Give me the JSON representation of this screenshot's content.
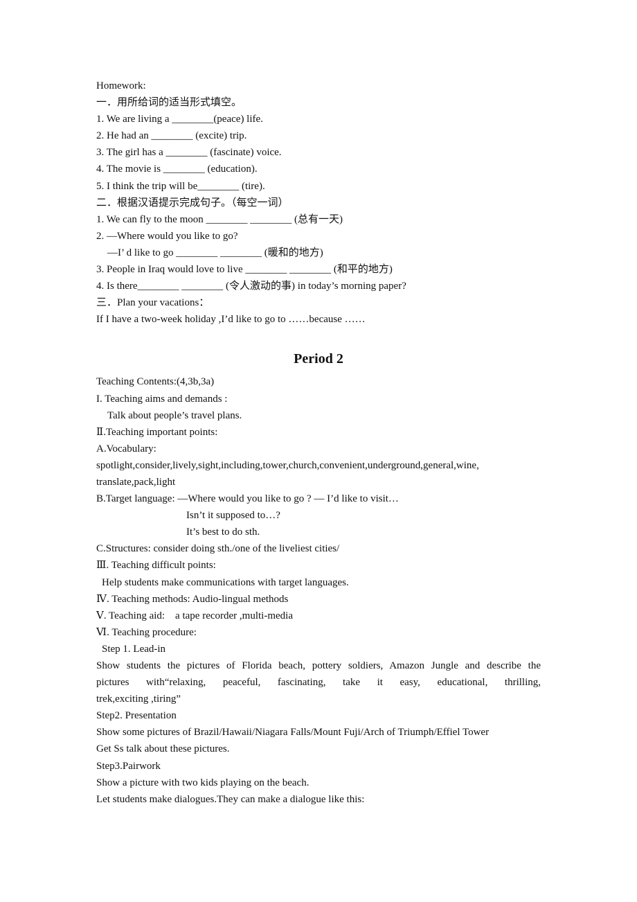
{
  "homework": {
    "heading": "Homework:",
    "section1": {
      "title": "一．用所给词的适当形式填空。",
      "items": [
        "1. We are living a ________(peace) life.",
        "2. He had an ________ (excite) trip.",
        "3. The girl has a ________ (fascinate) voice.",
        "4. The movie is ________ (education).",
        "5. I think the trip will be________ (tire)."
      ]
    },
    "section2": {
      "title": "二．根据汉语提示完成句子。（每空一词）",
      "items": [
        "1. We can fly to the moon ________ ________ (总有一天)",
        "2. —Where would you like to go?",
        "—I’ d like to go ________ ________ (暖和的地方)",
        "3. People in Iraq would love to live ________ ________ (和平的地方)",
        "4. Is there________ ________ (令人激动的事) in today’s morning paper?"
      ]
    },
    "section3": {
      "title": "三．Plan your vacations：",
      "prompt": "If I have a two-week holiday ,I’d like to go to ……because ……"
    }
  },
  "period": {
    "title": "Period 2",
    "contents": "Teaching Contents:(4,3b,3a)",
    "aims_heading": "I. Teaching aims and demands :",
    "aims_text": "Talk about people’s travel plans.",
    "important_heading": "Ⅱ.Teaching important points:",
    "vocab_heading": "A.Vocabulary:",
    "vocab_line1": "spotlight,consider,lively,sight,including,tower,church,convenient,underground,general,wine,",
    "vocab_line2": "translate,pack,light",
    "target_language": "B.Target language: —Where would you like to go ? — I’d like to visit…",
    "target_line2": "Isn’t it supposed to…?",
    "target_line3": "It’s best to do sth.",
    "structures": "C.Structures: consider doing sth./one of the liveliest cities/",
    "difficult_heading": "Ⅲ. Teaching difficult points:",
    "difficult_text": "Help students make communications with target languages.",
    "methods": "Ⅳ. Teaching methods: Audio-lingual methods",
    "aid": "Ⅴ. Teaching aid:    a tape recorder ,multi-media",
    "procedure_heading": "Ⅵ. Teaching procedure:",
    "step1_heading": "Step 1. Lead-in",
    "step1_line1": "Show students the pictures of Florida beach, pottery soldiers, Amazon Jungle and describe the",
    "step1_line2": "pictures with“relaxing, peaceful, fascinating, take it easy, educational, thrilling,",
    "step1_line3": "trek,exciting ,tiring”",
    "step2_heading": "Step2. Presentation",
    "step2_line1": "Show some pictures of Brazil/Hawaii/Niagara Falls/Mount Fuji/Arch of Triumph/Effiel Tower",
    "step2_line2": "Get Ss talk about these pictures.",
    "step3_heading": "Step3.Pairwork",
    "step3_line1": "Show a picture with two kids playing on the beach.",
    "step3_line2": "Let students make dialogues.They can make a dialogue like this:"
  }
}
